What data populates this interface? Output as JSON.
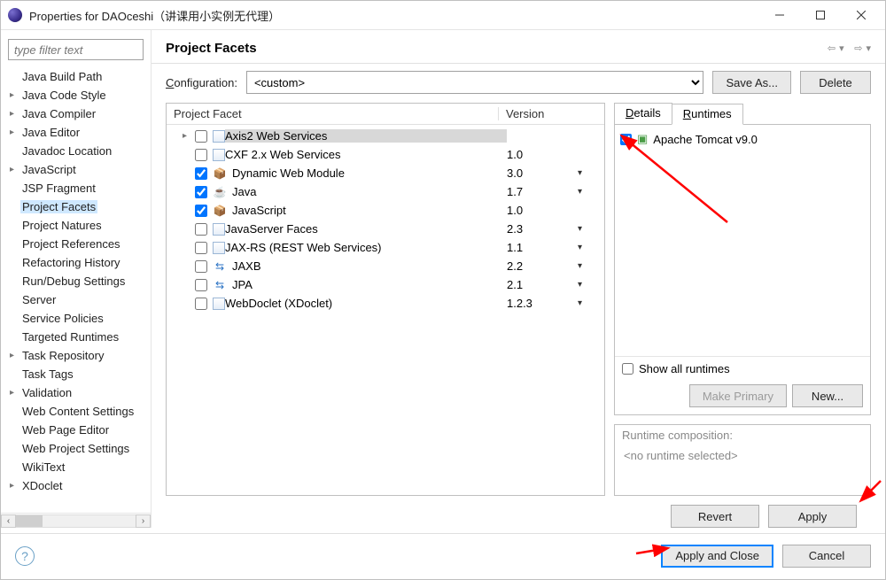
{
  "window": {
    "title": "Properties for DAOceshi（讲课用小实例无代理）"
  },
  "sidebar": {
    "filter_placeholder": "type filter text",
    "items": [
      {
        "label": "Java Build Path",
        "exp": false
      },
      {
        "label": "Java Code Style",
        "exp": true
      },
      {
        "label": "Java Compiler",
        "exp": true
      },
      {
        "label": "Java Editor",
        "exp": true
      },
      {
        "label": "Javadoc Location",
        "exp": false
      },
      {
        "label": "JavaScript",
        "exp": true
      },
      {
        "label": "JSP Fragment",
        "exp": false
      },
      {
        "label": "Project Facets",
        "exp": false,
        "selected": true
      },
      {
        "label": "Project Natures",
        "exp": false
      },
      {
        "label": "Project References",
        "exp": false
      },
      {
        "label": "Refactoring History",
        "exp": false
      },
      {
        "label": "Run/Debug Settings",
        "exp": false
      },
      {
        "label": "Server",
        "exp": false
      },
      {
        "label": "Service Policies",
        "exp": false
      },
      {
        "label": "Targeted Runtimes",
        "exp": false
      },
      {
        "label": "Task Repository",
        "exp": true
      },
      {
        "label": "Task Tags",
        "exp": false
      },
      {
        "label": "Validation",
        "exp": true
      },
      {
        "label": "Web Content Settings",
        "exp": false
      },
      {
        "label": "Web Page Editor",
        "exp": false
      },
      {
        "label": "Web Project Settings",
        "exp": false
      },
      {
        "label": "WikiText",
        "exp": false
      },
      {
        "label": "XDoclet",
        "exp": true
      }
    ]
  },
  "page": {
    "title": "Project Facets",
    "config_label": "Configuration:",
    "config_value": "<custom>",
    "save_as": "Save As...",
    "delete": "Delete",
    "col_facet": "Project Facet",
    "col_version": "Version",
    "facets": [
      {
        "name": "Axis2 Web Services",
        "version": "",
        "checked": false,
        "expandable": true,
        "selected": true,
        "icon": "doc"
      },
      {
        "name": "CXF 2.x Web Services",
        "version": "1.0",
        "checked": false,
        "icon": "doc"
      },
      {
        "name": "Dynamic Web Module",
        "version": "3.0",
        "checked": true,
        "dd": true,
        "icon": "jar"
      },
      {
        "name": "Java",
        "version": "1.7",
        "checked": true,
        "dd": true,
        "icon": "java"
      },
      {
        "name": "JavaScript",
        "version": "1.0",
        "checked": true,
        "icon": "jar"
      },
      {
        "name": "JavaServer Faces",
        "version": "2.3",
        "checked": false,
        "dd": true,
        "icon": "doc"
      },
      {
        "name": "JAX-RS (REST Web Services)",
        "version": "1.1",
        "checked": false,
        "dd": true,
        "icon": "doc"
      },
      {
        "name": "JAXB",
        "version": "2.2",
        "checked": false,
        "dd": true,
        "icon": "blue"
      },
      {
        "name": "JPA",
        "version": "2.1",
        "checked": false,
        "dd": true,
        "icon": "blue"
      },
      {
        "name": "WebDoclet (XDoclet)",
        "version": "1.2.3",
        "checked": false,
        "dd": true,
        "icon": "doc"
      }
    ],
    "tabs": {
      "details": "Details",
      "runtimes": "Runtimes"
    },
    "runtime": {
      "name": "Apache Tomcat v9.0",
      "checked": true
    },
    "show_all": "Show all runtimes",
    "make_primary": "Make Primary",
    "new": "New...",
    "composition_label": "Runtime composition:",
    "composition_empty": "<no runtime selected>",
    "revert": "Revert",
    "apply": "Apply",
    "apply_close": "Apply and Close",
    "cancel": "Cancel"
  }
}
